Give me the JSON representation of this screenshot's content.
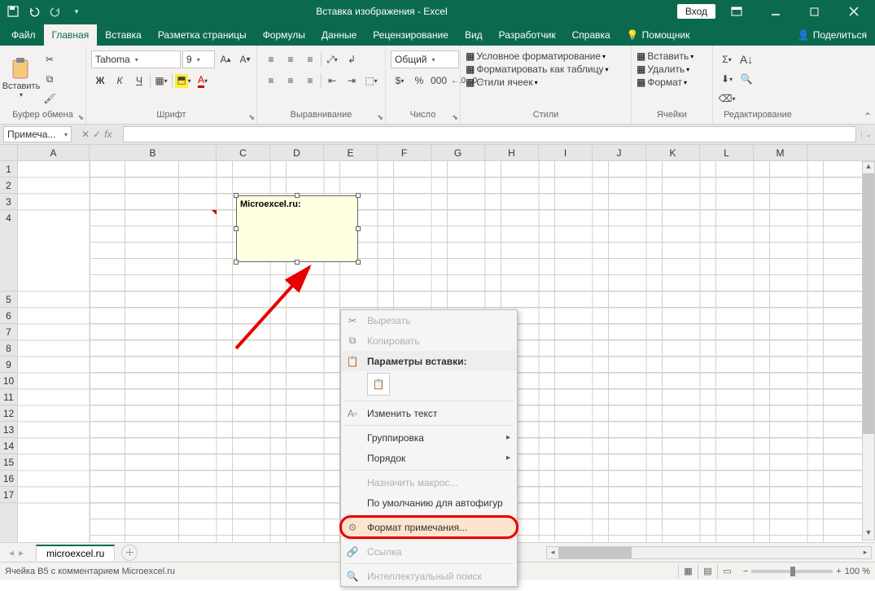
{
  "titlebar": {
    "title": "Вставка изображения - Excel",
    "signin": "Вход"
  },
  "tabs": {
    "file": "Файл",
    "home": "Главная",
    "insert": "Вставка",
    "pagelayout": "Разметка страницы",
    "formulas": "Формулы",
    "data": "Данные",
    "review": "Рецензирование",
    "view": "Вид",
    "developer": "Разработчик",
    "help": "Справка",
    "tellme": "Помощник",
    "share": "Поделиться"
  },
  "ribbon": {
    "clipboard": {
      "label": "Буфер обмена",
      "paste": "Вставить"
    },
    "font": {
      "label": "Шрифт",
      "family": "Tahoma",
      "size": "9",
      "bold": "Ж",
      "italic": "К",
      "underline": "Ч"
    },
    "alignment": {
      "label": "Выравнивание"
    },
    "number": {
      "label": "Число",
      "format": "Общий"
    },
    "styles": {
      "label": "Стили",
      "cond": "Условное форматирование",
      "astable": "Форматировать как таблицу",
      "cellstyles": "Стили ячеек"
    },
    "cells": {
      "label": "Ячейки",
      "insert": "Вставить",
      "delete": "Удалить",
      "format": "Формат"
    },
    "editing": {
      "label": "Редактирование"
    }
  },
  "namebox": {
    "value": "Примеча..."
  },
  "columns": [
    "A",
    "B",
    "C",
    "D",
    "E",
    "F",
    "G",
    "H",
    "I",
    "J",
    "K",
    "L",
    "M"
  ],
  "rows": [
    1,
    2,
    3,
    4,
    5,
    6,
    7,
    8,
    9,
    10,
    11,
    12,
    13,
    14,
    15,
    16,
    17
  ],
  "comment": {
    "author": "Microexcel.ru:"
  },
  "context": {
    "cut": "Вырезать",
    "copy": "Копировать",
    "paste_header": "Параметры вставки:",
    "edit_text": "Изменить текст",
    "group": "Группировка",
    "order": "Порядок",
    "assign_macro": "Назначить макрос...",
    "default_autoshape": "По умолчанию для автофигур",
    "format_comment": "Формат примечания...",
    "link": "Ссылка",
    "smart_lookup": "Интеллектуальный поиск"
  },
  "sheet": {
    "name": "microexcel.ru"
  },
  "status": {
    "text": "Ячейка B5 с комментарием Microexcel.ru",
    "zoom": "100 %"
  }
}
